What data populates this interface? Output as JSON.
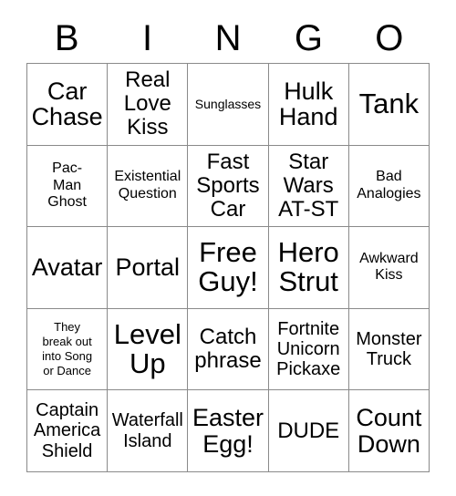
{
  "card": {
    "title": "BINGO",
    "header_letters": [
      "B",
      "I",
      "N",
      "G",
      "O"
    ],
    "colors": {
      "background": "#ffffff",
      "text": "#000000",
      "border": "#8a8a8a"
    },
    "grid_size": "5x5",
    "rows": [
      [
        {
          "text": "Car\nChase",
          "size": "xl"
        },
        {
          "text": "Real\nLove\nKiss",
          "size": "lg"
        },
        {
          "text": "Sunglasses",
          "size": "xs"
        },
        {
          "text": "Hulk\nHand",
          "size": "xl"
        },
        {
          "text": "Tank",
          "size": "xxl"
        }
      ],
      [
        {
          "text": "Pac-\nMan\nGhost",
          "size": "sm"
        },
        {
          "text": "Existential\nQuestion",
          "size": "sm"
        },
        {
          "text": "Fast\nSports\nCar",
          "size": "lg"
        },
        {
          "text": "Star\nWars\nAT-ST",
          "size": "lg"
        },
        {
          "text": "Bad\nAnalogies",
          "size": "sm"
        }
      ],
      [
        {
          "text": "Avatar",
          "size": "xl"
        },
        {
          "text": "Portal",
          "size": "xl"
        },
        {
          "text": "Free\nGuy!",
          "size": "xxl"
        },
        {
          "text": "Hero\nStrut",
          "size": "xxl"
        },
        {
          "text": "Awkward\nKiss",
          "size": "sm"
        }
      ],
      [
        {
          "text": "They\nbreak out\ninto Song\nor Dance",
          "size": "xxs"
        },
        {
          "text": "Level\nUp",
          "size": "xxl"
        },
        {
          "text": "Catch\nphrase",
          "size": "lg"
        },
        {
          "text": "Fortnite\nUnicorn\nPickaxe",
          "size": "md"
        },
        {
          "text": "Monster\nTruck",
          "size": "md"
        }
      ],
      [
        {
          "text": "Captain\nAmerica\nShield",
          "size": "md"
        },
        {
          "text": "Waterfall\nIsland",
          "size": "md"
        },
        {
          "text": "Easter\nEgg!",
          "size": "xl"
        },
        {
          "text": "DUDE",
          "size": "lg"
        },
        {
          "text": "Count\nDown",
          "size": "xl"
        }
      ]
    ]
  }
}
